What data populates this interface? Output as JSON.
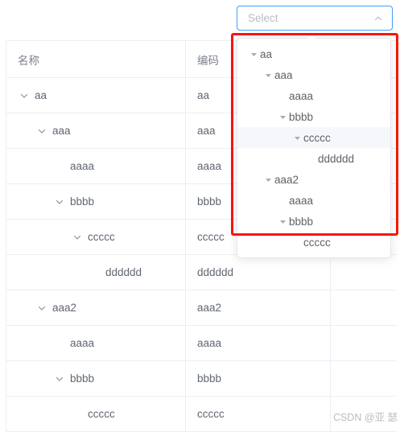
{
  "select": {
    "placeholder": "Select",
    "value": "",
    "caret_icon": "chevron-up-icon",
    "border_color": "#409eff"
  },
  "table": {
    "columns": [
      {
        "key": "name",
        "label": "名称"
      },
      {
        "key": "code",
        "label": "编码"
      },
      {
        "key": "extra",
        "label": ""
      }
    ],
    "rows": [
      {
        "name": "aa",
        "code": "aa",
        "level": 0,
        "expandable": true,
        "icon": "chevron-down-icon"
      },
      {
        "name": "aaa",
        "code": "aaa",
        "level": 1,
        "expandable": true,
        "icon": "chevron-down-icon"
      },
      {
        "name": "aaaa",
        "code": "aaaa",
        "level": 2,
        "expandable": false,
        "icon": ""
      },
      {
        "name": "bbbb",
        "code": "bbbb",
        "level": 2,
        "expandable": true,
        "icon": "chevron-down-icon"
      },
      {
        "name": "ccccc",
        "code": "ccccc",
        "level": 3,
        "expandable": true,
        "icon": "chevron-down-icon"
      },
      {
        "name": "dddddd",
        "code": "dddddd",
        "level": 4,
        "expandable": false,
        "icon": ""
      },
      {
        "name": "aaa2",
        "code": "aaa2",
        "level": 1,
        "expandable": true,
        "icon": "chevron-down-icon"
      },
      {
        "name": "aaaa",
        "code": "aaaa",
        "level": 2,
        "expandable": false,
        "icon": ""
      },
      {
        "name": "bbbb",
        "code": "bbbb",
        "level": 2,
        "expandable": true,
        "icon": "chevron-down-icon"
      },
      {
        "name": "ccccc",
        "code": "ccccc",
        "level": 3,
        "expandable": false,
        "icon": ""
      }
    ]
  },
  "dropdown": {
    "visible": true,
    "highlight_color": "#f5f7fa",
    "nodes": [
      {
        "label": "aa",
        "level": 0,
        "expandable": true,
        "icon": "caret-down-icon",
        "highlighted": false
      },
      {
        "label": "aaa",
        "level": 1,
        "expandable": true,
        "icon": "caret-down-icon",
        "highlighted": false
      },
      {
        "label": "aaaa",
        "level": 2,
        "expandable": false,
        "icon": "",
        "highlighted": false
      },
      {
        "label": "bbbb",
        "level": 2,
        "expandable": true,
        "icon": "caret-down-icon",
        "highlighted": false
      },
      {
        "label": "ccccc",
        "level": 3,
        "expandable": true,
        "icon": "caret-down-icon",
        "highlighted": true
      },
      {
        "label": "dddddd",
        "level": 4,
        "expandable": false,
        "icon": "",
        "highlighted": false
      },
      {
        "label": "aaa2",
        "level": 1,
        "expandable": true,
        "icon": "caret-down-icon",
        "highlighted": false
      },
      {
        "label": "aaaa",
        "level": 2,
        "expandable": false,
        "icon": "",
        "highlighted": false
      },
      {
        "label": "bbbb",
        "level": 2,
        "expandable": true,
        "icon": "caret-down-icon",
        "highlighted": false
      },
      {
        "label": "ccccc",
        "level": 3,
        "expandable": false,
        "icon": "",
        "highlighted": false
      }
    ]
  },
  "annotation": {
    "type": "red-rectangle",
    "color": "#fc1404"
  },
  "watermark": {
    "text": "CSDN @亚 瑟"
  }
}
